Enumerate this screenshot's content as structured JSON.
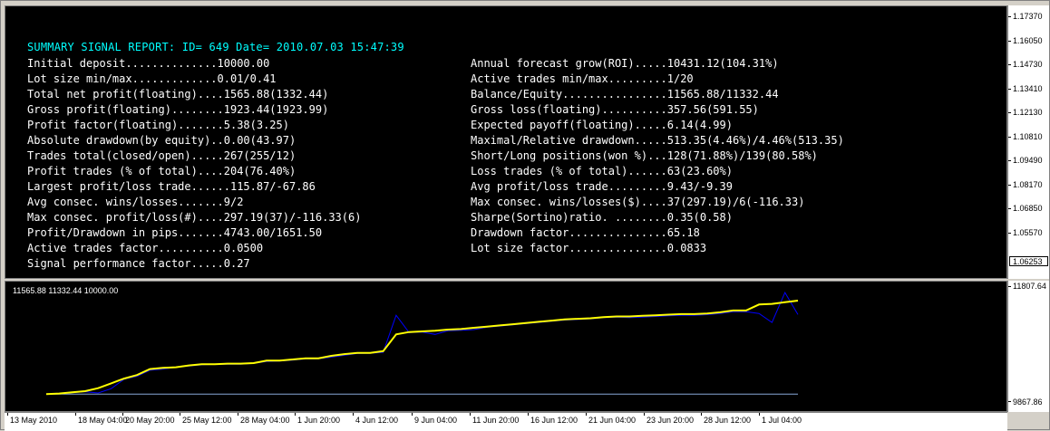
{
  "report": {
    "title": "SUMMARY SIGNAL REPORT: ID= 649 Date= 2010.07.03 15:47:39",
    "left": [
      "Initial deposit..............10000.00",
      "Lot size min/max.............0.01/0.41",
      "Total net profit(floating)....1565.88(1332.44)",
      "Gross profit(floating)........1923.44(1923.99)",
      "Profit factor(floating).......5.38(3.25)",
      "Absolute drawdown(by equity)..0.00(43.97)",
      "Trades total(closed/open).....267(255/12)",
      "Profit trades (% of total)....204(76.40%)",
      "Largest profit/loss trade......115.87/-67.86",
      "Avg consec. wins/losses.......9/2",
      "Max consec. profit/loss(#)....297.19(37)/-116.33(6)",
      "Profit/Drawdown in pips.......4743.00/1651.50",
      "Active trades factor..........0.0500",
      "Signal performance factor.....0.27"
    ],
    "right": [
      "Annual forecast grow(ROI).....10431.12(104.31%)",
      "Active trades min/max.........1/20",
      "Balance/Equity................11565.88/11332.44",
      "Gross loss(floating)..........357.56(591.55)",
      "Expected payoff(floating).....6.14(4.99)",
      "Maximal/Relative drawdown.....513.35(4.46%)/4.46%(513.35)",
      "Short/Long positions(won %)...128(71.88%)/139(80.58%)",
      "Loss trades (% of total)......63(23.60%)",
      "Avg profit/loss trade.........9.43/-9.39",
      "Max consec. wins/losses($)....37(297.19)/6(-116.33)",
      "Sharpe(Sortino)ratio. ........0.35(0.58)",
      "Drawdown factor...............65.18",
      "Lot size factor...............0.0833"
    ]
  },
  "price_scale": [
    "1.17370",
    "1.16050",
    "1.14730",
    "1.13410",
    "1.12130",
    "1.10810",
    "1.09490",
    "1.08170",
    "1.06850",
    "1.05570"
  ],
  "current_price": "1.06253",
  "sub_window": {
    "info": "11565.88 11332.44 10000.00",
    "scale_top": "11807.64",
    "scale_bottom": "9867.86"
  },
  "time_axis": [
    "13 May 2010",
    "18 May 04:00",
    "20 May 20:00",
    "25 May 12:00",
    "28 May 04:00",
    "1 Jun 20:00",
    "4 Jun 12:00",
    "9 Jun 04:00",
    "11 Jun 20:00",
    "16 Jun 12:00",
    "21 Jun 04:00",
    "23 Jun 20:00",
    "28 Jun 12:00",
    "1 Jul 04:00"
  ],
  "colors": {
    "background": "#000000",
    "title": "#00ffff",
    "text": "#ffffff",
    "balance_line": "#ffff00",
    "equity_line": "#0000ff",
    "deposit_line": "#87a8d8"
  },
  "chart_data": {
    "type": "line",
    "x_range": [
      "13 May 2010",
      "1 Jul 04:00"
    ],
    "ylim": [
      9867.86,
      11807.64
    ],
    "series": [
      {
        "name": "balance",
        "values": [
          10000,
          10010,
          10030,
          10050,
          10100,
          10180,
          10260,
          10320,
          10420,
          10440,
          10450,
          10480,
          10500,
          10500,
          10510,
          10510,
          10520,
          10560,
          10560,
          10580,
          10600,
          10600,
          10640,
          10670,
          10690,
          10690,
          10720,
          11000,
          11040,
          11050,
          11060,
          11080,
          11090,
          11110,
          11130,
          11150,
          11170,
          11190,
          11210,
          11230,
          11250,
          11260,
          11270,
          11290,
          11300,
          11300,
          11310,
          11320,
          11330,
          11340,
          11340,
          11350,
          11370,
          11400,
          11400,
          11500,
          11510,
          11540,
          11565.88
        ]
      },
      {
        "name": "equity",
        "values": [
          10000,
          10005,
          10025,
          10040,
          10020,
          10090,
          10250,
          10300,
          10400,
          10420,
          10450,
          10470,
          10490,
          10500,
          10500,
          10500,
          10515,
          10545,
          10555,
          10570,
          10590,
          10590,
          10620,
          10650,
          10680,
          10685,
          10700,
          11320,
          11030,
          11040,
          11000,
          11060,
          11070,
          11080,
          11120,
          11140,
          11160,
          11180,
          11200,
          11220,
          11240,
          11250,
          11260,
          11280,
          11290,
          11280,
          11290,
          11300,
          11310,
          11320,
          11320,
          11330,
          11350,
          11380,
          11380,
          11350,
          11200,
          11700,
          11332.44
        ]
      },
      {
        "name": "deposit",
        "values": [
          10000,
          10000
        ]
      }
    ]
  }
}
